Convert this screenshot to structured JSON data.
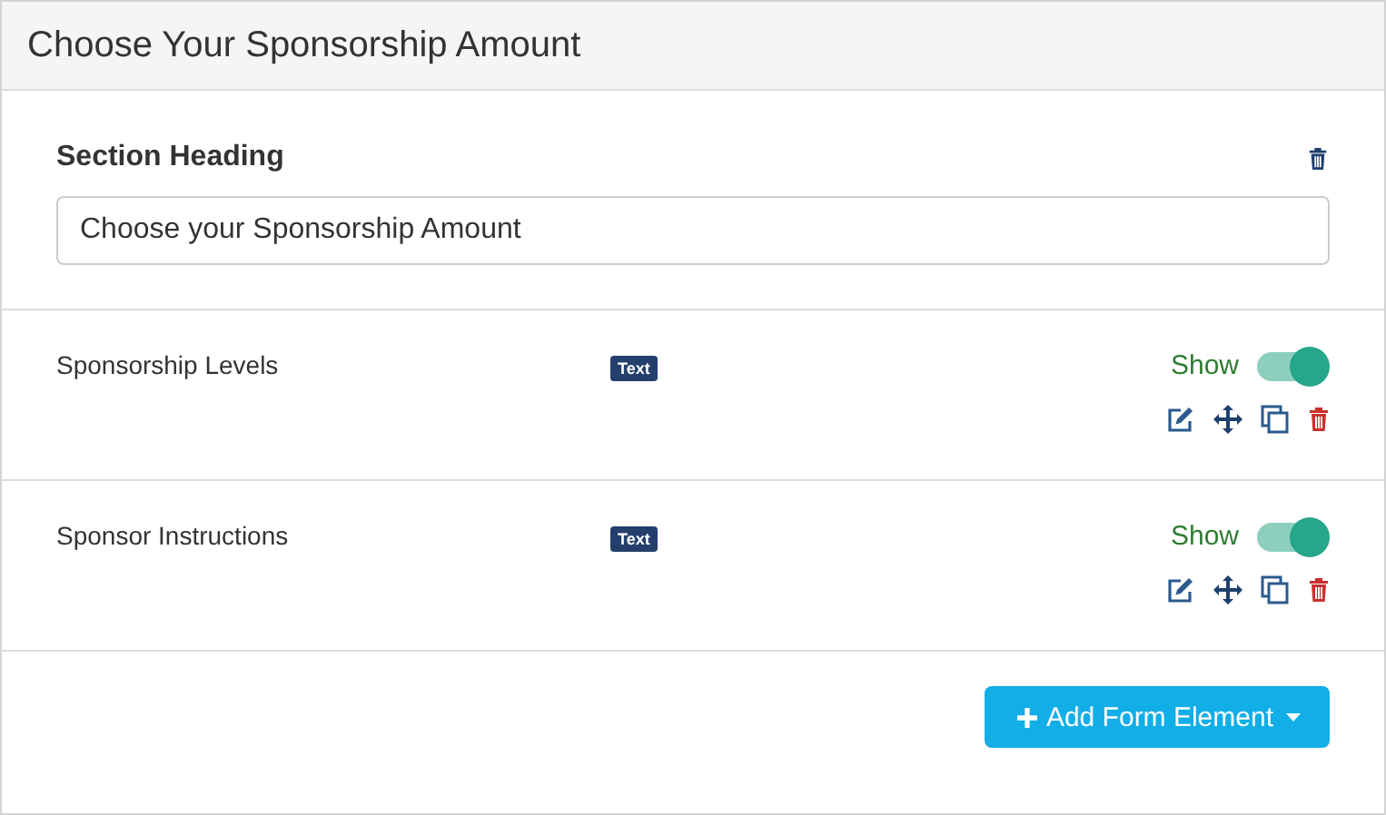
{
  "panel": {
    "title": "Choose Your Sponsorship Amount"
  },
  "section": {
    "label": "Section Heading",
    "value": "Choose your Sponsorship Amount"
  },
  "elements": [
    {
      "name": "Sponsorship Levels",
      "type_badge": "Text",
      "toggle_label": "Show",
      "on": true
    },
    {
      "name": "Sponsor Instructions",
      "type_badge": "Text",
      "toggle_label": "Show",
      "on": true
    }
  ],
  "add_button": {
    "label": "Add Form Element"
  }
}
